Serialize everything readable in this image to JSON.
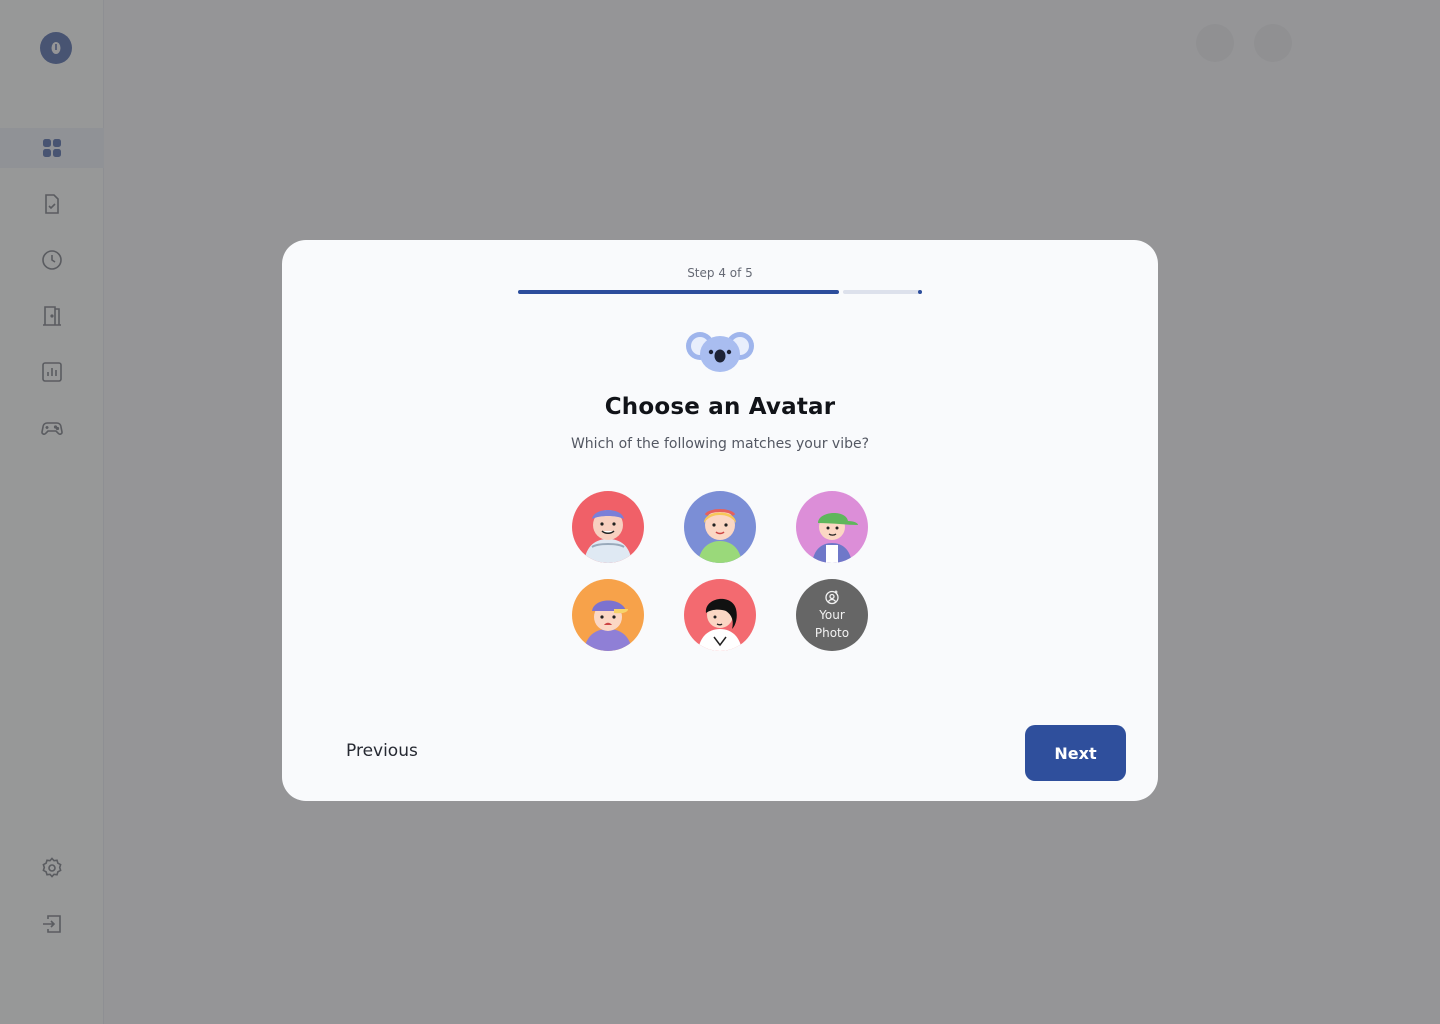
{
  "app": {
    "logo_icon": "app-logo-icon",
    "accent_color": "#2c4d9c"
  },
  "sidebar": {
    "items": [
      {
        "icon": "dashboard-grid-icon",
        "active": true
      },
      {
        "icon": "document-check-icon",
        "active": false
      },
      {
        "icon": "clock-icon",
        "active": false
      },
      {
        "icon": "door-icon",
        "active": false
      },
      {
        "icon": "bar-chart-icon",
        "active": false
      },
      {
        "icon": "gamepad-icon",
        "active": false
      }
    ],
    "bottom_items": [
      {
        "icon": "settings-gear-icon"
      },
      {
        "icon": "logout-icon"
      }
    ]
  },
  "modal": {
    "step_label": "Step 4 of 5",
    "progress": {
      "current": 4,
      "total": 5
    },
    "mascot_icon": "koala-icon",
    "title": "Choose an Avatar",
    "subtitle": "Which of the following matches your vibe?",
    "avatars": [
      {
        "name": "avatar-option-1",
        "bg": "#f06068"
      },
      {
        "name": "avatar-option-2",
        "bg": "#7b8ed6"
      },
      {
        "name": "avatar-option-3",
        "bg": "#dc8ed8"
      },
      {
        "name": "avatar-option-4",
        "bg": "#f7a24a"
      },
      {
        "name": "avatar-option-5",
        "bg": "#f36a70"
      }
    ],
    "photo_option": {
      "line1": "Your",
      "line2": "Photo",
      "icon": "camera-user-icon"
    },
    "previous_label": "Previous",
    "next_label": "Next"
  }
}
